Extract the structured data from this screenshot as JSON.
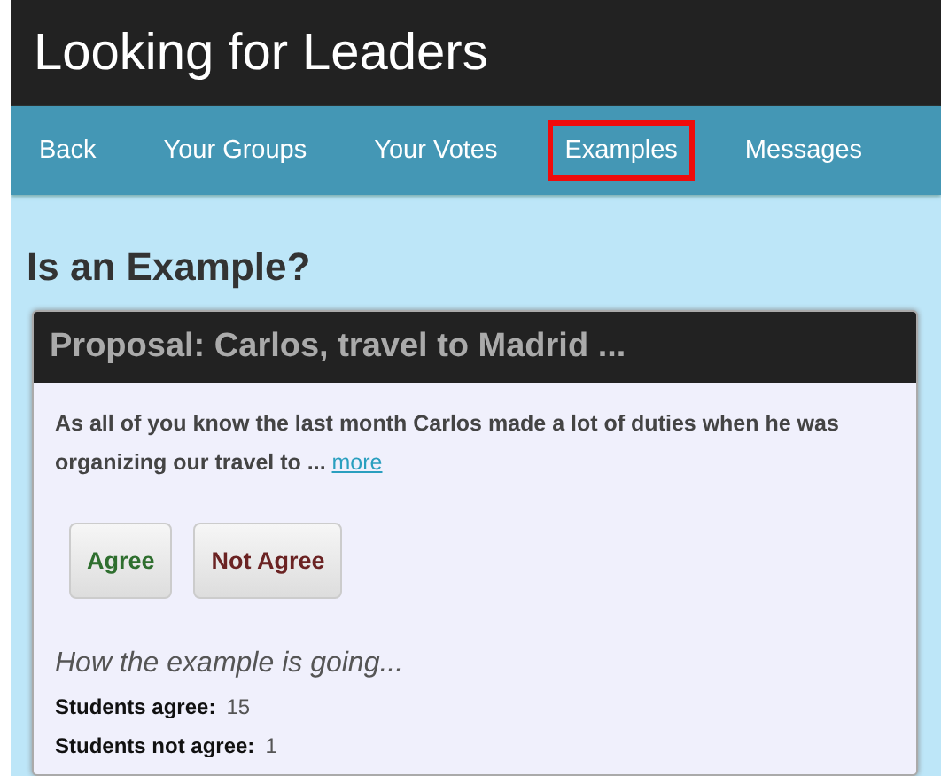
{
  "app": {
    "title": "Looking for Leaders"
  },
  "nav": [
    {
      "label": "Back",
      "selected": false
    },
    {
      "label": "Your Groups",
      "selected": false
    },
    {
      "label": "Your Votes",
      "selected": false
    },
    {
      "label": "Examples",
      "selected": true
    },
    {
      "label": "Messages",
      "selected": false
    }
  ],
  "page_title": "Is an Example?",
  "proposal": {
    "title": "Proposal:  Carlos, travel to Madrid ...",
    "body": "As all of you know the last month Carlos made a lot of duties when he was organizing our travel to ...",
    "more_link": "more",
    "buttons": [
      {
        "label": "Agree",
        "kind": "agree"
      },
      {
        "label": "Not Agree",
        "kind": "disagree"
      }
    ],
    "progress_heading": "How the example is going...",
    "stats": [
      {
        "label": "Students agree:",
        "value": "15"
      },
      {
        "label": "Students not agree:",
        "value": "1"
      }
    ]
  }
}
